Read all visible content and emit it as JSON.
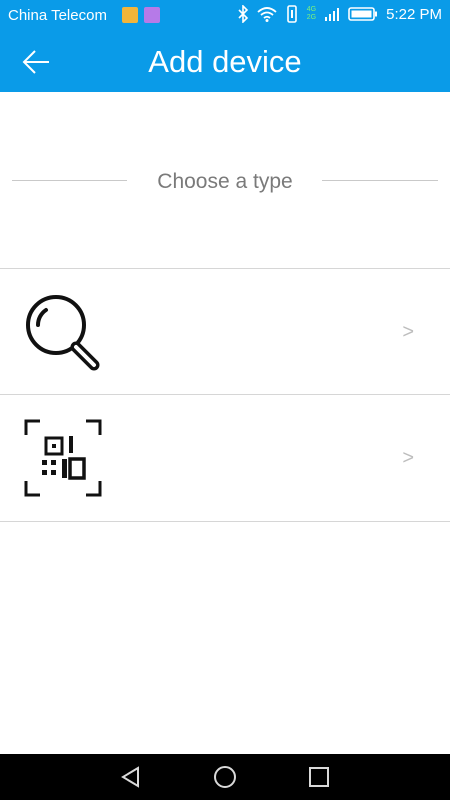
{
  "status_bar": {
    "carrier": "China Telecom",
    "time": "5:22 PM",
    "network_top": "4G",
    "network_bottom": "2G",
    "icons": [
      "notification-app-icon",
      "gallery-app-icon",
      "bluetooth-icon",
      "wifi-icon",
      "vibrate-icon",
      "signal-icon",
      "battery-icon"
    ]
  },
  "toolbar": {
    "title": "Add device",
    "back_icon": "arrow-left-icon"
  },
  "section": {
    "title": "Choose a type"
  },
  "options": [
    {
      "icon": "search-icon",
      "chevron": ">"
    },
    {
      "icon": "qr-scan-icon",
      "chevron": ">"
    }
  ],
  "nav_bar": {
    "icons": [
      "back-triangle-icon",
      "home-circle-icon",
      "recents-square-icon"
    ]
  },
  "colors": {
    "primary": "#0a9be8",
    "text_secondary": "#7a7a7a",
    "divider": "#d6d6d6",
    "nav_background": "#000000"
  }
}
